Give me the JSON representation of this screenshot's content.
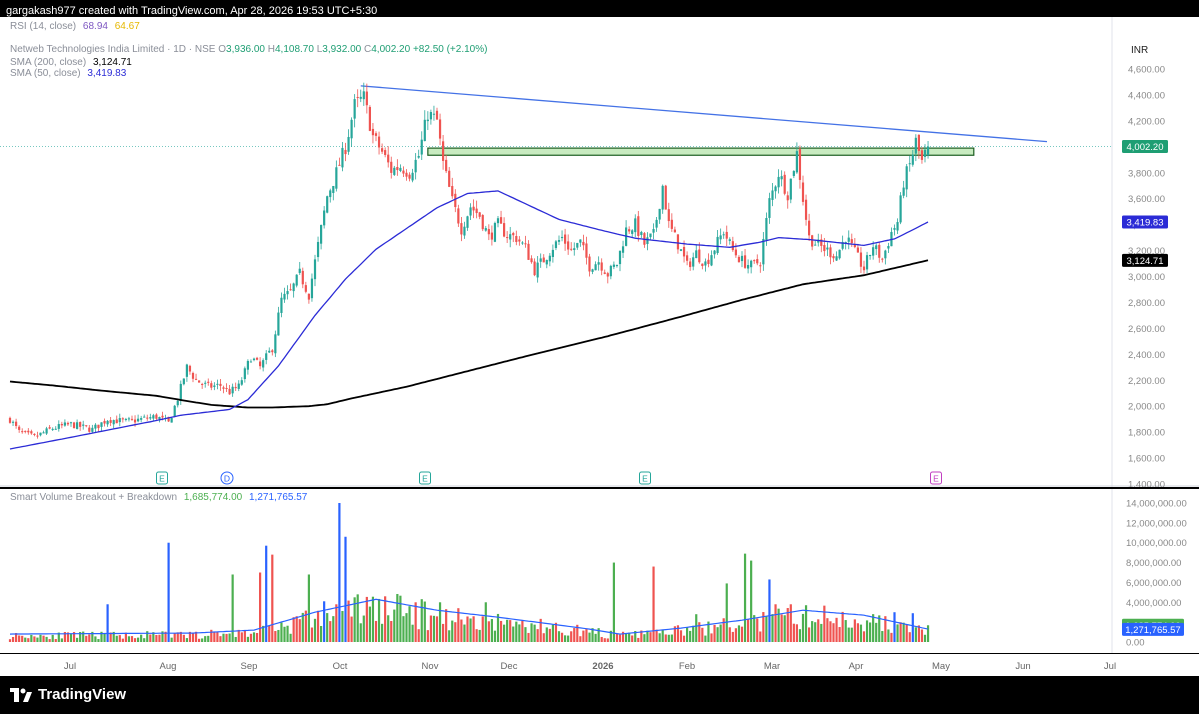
{
  "header": {
    "caption": "gargakash977 created with TradingView.com, Apr 28, 2026 19:53 UTC+5:30"
  },
  "rsi": {
    "label": "RSI (14, close)",
    "v1": "68.94",
    "v2": "64.67"
  },
  "legend": {
    "symbol": "Netweb Technologies India Limited · 1D · NSE",
    "o_label": "O",
    "o": "3,936.00",
    "h_label": "H",
    "h": "4,108.70",
    "l_label": "L",
    "l": "3,932.00",
    "c_label": "C",
    "c": "4,002.20",
    "change": "+82.50 (+2.10%)",
    "sma200_label": "SMA (200, close)",
    "sma200": "3,124.71",
    "sma50_label": "SMA (50, close)",
    "sma50": "3,419.83"
  },
  "volume_legend": {
    "label": "Smart Volume Breakout + Breakdown",
    "v1": "1,685,774.00",
    "v2": "1,271,765.57"
  },
  "currency": "INR",
  "footer": {
    "brand": "TradingView"
  },
  "colors": {
    "up": "#26a69a",
    "down": "#ef5350",
    "sma50": "#2b2bd6",
    "sma200": "#000000",
    "trendline": "#4472e6",
    "vol_green": "#4caf50",
    "vol_red": "#ef5350",
    "vol_blue": "#2962ff"
  },
  "chart_data": {
    "type": "candlestick",
    "price_axis": {
      "ylim": [
        1400,
        4700
      ],
      "ticks": [
        "1,400.00",
        "1,600.00",
        "1,800.00",
        "2,000.00",
        "2,200.00",
        "2,400.00",
        "2,600.00",
        "2,800.00",
        "3,000.00",
        "3,200.00",
        "3,400.00",
        "3,600.00",
        "3,800.00",
        "4,000.00",
        "4,200.00",
        "4,400.00",
        "4,600.00"
      ]
    },
    "price_labels": [
      {
        "text": "4,002.20",
        "value": 4002.2,
        "color": "#1e9e73"
      },
      {
        "text": "3,419.83",
        "value": 3419.83,
        "color": "#2b2bd6"
      },
      {
        "text": "3,124.71",
        "value": 3124.71,
        "color": "#000000"
      }
    ],
    "volume_axis": {
      "ylim": [
        0,
        15000000
      ],
      "ticks": [
        "0.00",
        "2,000,000.00",
        "4,000,000.00",
        "6,000,000.00",
        "8,000,000.00",
        "10,000,000.00",
        "12,000,000.00",
        "14,000,000.00"
      ]
    },
    "volume_labels": [
      {
        "text": "1,685,774.00",
        "value": 1685774,
        "color": "#4caf50"
      },
      {
        "text": "1,271,765.57",
        "value": 1271765.57,
        "color": "#2962ff"
      }
    ],
    "x_labels": [
      "Jul",
      "Aug",
      "Sep",
      "Oct",
      "Nov",
      "Dec",
      "2026",
      "Feb",
      "Mar",
      "Apr",
      "May",
      "Jun",
      "Jul"
    ],
    "events": [
      "E",
      "D",
      "E",
      "E",
      "E"
    ],
    "anchors": [
      [
        0,
        1900
      ],
      [
        3,
        1800
      ],
      [
        8,
        1760
      ],
      [
        14,
        1830
      ],
      [
        20,
        1860
      ],
      [
        27,
        1820
      ],
      [
        32,
        1900
      ],
      [
        38,
        1880
      ],
      [
        43,
        1900
      ],
      [
        48,
        1920
      ],
      [
        52,
        1870
      ],
      [
        55,
        2060
      ],
      [
        58,
        2300
      ],
      [
        61,
        2200
      ],
      [
        65,
        2150
      ],
      [
        69,
        2160
      ],
      [
        72,
        2110
      ],
      [
        75,
        2150
      ],
      [
        79,
        2380
      ],
      [
        82,
        2300
      ],
      [
        86,
        2450
      ],
      [
        89,
        2820
      ],
      [
        92,
        2880
      ],
      [
        95,
        3020
      ],
      [
        98,
        2860
      ],
      [
        101,
        3240
      ],
      [
        104,
        3620
      ],
      [
        107,
        3800
      ],
      [
        110,
        4000
      ],
      [
        113,
        4320
      ],
      [
        116,
        4380
      ],
      [
        119,
        4080
      ],
      [
        122,
        3960
      ],
      [
        125,
        3820
      ],
      [
        128,
        3850
      ],
      [
        131,
        3800
      ],
      [
        134,
        3930
      ],
      [
        137,
        4260
      ],
      [
        140,
        4200
      ],
      [
        142,
        3870
      ],
      [
        145,
        3580
      ],
      [
        148,
        3370
      ],
      [
        151,
        3540
      ],
      [
        154,
        3470
      ],
      [
        157,
        3300
      ],
      [
        160,
        3400
      ],
      [
        163,
        3320
      ],
      [
        166,
        3300
      ],
      [
        169,
        3220
      ],
      [
        172,
        3050
      ],
      [
        175,
        3130
      ],
      [
        178,
        3230
      ],
      [
        181,
        3300
      ],
      [
        184,
        3200
      ],
      [
        187,
        3260
      ],
      [
        190,
        3080
      ],
      [
        193,
        3120
      ],
      [
        196,
        3020
      ],
      [
        199,
        3100
      ],
      [
        202,
        3360
      ],
      [
        205,
        3400
      ],
      [
        208,
        3250
      ],
      [
        211,
        3320
      ],
      [
        214,
        3700
      ],
      [
        216,
        3400
      ],
      [
        219,
        3250
      ],
      [
        222,
        3080
      ],
      [
        225,
        3180
      ],
      [
        228,
        3100
      ],
      [
        231,
        3220
      ],
      [
        234,
        3350
      ],
      [
        237,
        3200
      ],
      [
        240,
        3120
      ],
      [
        243,
        3080
      ],
      [
        246,
        3120
      ],
      [
        249,
        3580
      ],
      [
        252,
        3800
      ],
      [
        255,
        3640
      ],
      [
        258,
        3950
      ],
      [
        260,
        3600
      ],
      [
        262,
        3300
      ],
      [
        265,
        3240
      ],
      [
        268,
        3200
      ],
      [
        271,
        3160
      ],
      [
        274,
        3310
      ],
      [
        277,
        3180
      ],
      [
        280,
        3060
      ],
      [
        283,
        3240
      ],
      [
        286,
        3130
      ],
      [
        289,
        3340
      ],
      [
        291,
        3420
      ],
      [
        293,
        3730
      ],
      [
        295,
        3860
      ],
      [
        297,
        4040
      ],
      [
        299,
        3880
      ],
      [
        301,
        4002
      ]
    ],
    "sma50": [
      [
        0,
        1670
      ],
      [
        20,
        1760
      ],
      [
        46,
        1880
      ],
      [
        56,
        1930
      ],
      [
        72,
        1975
      ],
      [
        78,
        2050
      ],
      [
        88,
        2310
      ],
      [
        100,
        2700
      ],
      [
        110,
        2980
      ],
      [
        120,
        3210
      ],
      [
        140,
        3530
      ],
      [
        150,
        3640
      ],
      [
        160,
        3660
      ],
      [
        170,
        3550
      ],
      [
        180,
        3440
      ],
      [
        195,
        3350
      ],
      [
        205,
        3295
      ],
      [
        222,
        3250
      ],
      [
        236,
        3225
      ],
      [
        246,
        3265
      ],
      [
        252,
        3300
      ],
      [
        262,
        3285
      ],
      [
        280,
        3240
      ],
      [
        290,
        3290
      ],
      [
        296,
        3360
      ],
      [
        301,
        3420
      ]
    ],
    "sma200": [
      [
        0,
        2190
      ],
      [
        14,
        2160
      ],
      [
        30,
        2120
      ],
      [
        48,
        2080
      ],
      [
        58,
        2040
      ],
      [
        66,
        2010
      ],
      [
        78,
        1990
      ],
      [
        86,
        1990
      ],
      [
        98,
        2000
      ],
      [
        104,
        2015
      ],
      [
        112,
        2060
      ],
      [
        130,
        2150
      ],
      [
        150,
        2270
      ],
      [
        170,
        2390
      ],
      [
        196,
        2540
      ],
      [
        220,
        2690
      ],
      [
        240,
        2820
      ],
      [
        260,
        2940
      ],
      [
        280,
        3010
      ],
      [
        301,
        3125
      ]
    ],
    "trendline": {
      "from": [
        115,
        4470
      ],
      "to": [
        340,
        4040
      ]
    },
    "zone": {
      "from": 137,
      "to": 316,
      "low": 3935,
      "high": 3990
    },
    "volume": {
      "base_millions": 1.0,
      "ma_millions": [
        [
          0,
          0.8
        ],
        [
          60,
          0.9
        ],
        [
          80,
          1.2
        ],
        [
          100,
          3.0
        ],
        [
          120,
          4.3
        ],
        [
          140,
          3.2
        ],
        [
          160,
          2.5
        ],
        [
          190,
          1.3
        ],
        [
          200,
          0.8
        ],
        [
          220,
          1.4
        ],
        [
          240,
          2.2
        ],
        [
          260,
          3.2
        ],
        [
          280,
          2.7
        ],
        [
          301,
          1.3
        ]
      ],
      "spikes": [
        [
          32,
          3.8,
          "blue"
        ],
        [
          52,
          10.0,
          "blue"
        ],
        [
          73,
          6.8,
          "green"
        ],
        [
          82,
          7.0,
          "red"
        ],
        [
          84,
          9.7,
          "blue"
        ],
        [
          86,
          8.8,
          "red"
        ],
        [
          98,
          6.8,
          "green"
        ],
        [
          103,
          4.1,
          "blue"
        ],
        [
          108,
          14.0,
          "blue"
        ],
        [
          110,
          10.6,
          "blue"
        ],
        [
          114,
          4.8,
          "green"
        ],
        [
          133,
          4.0,
          "red"
        ],
        [
          141,
          4.0,
          "green"
        ],
        [
          156,
          4.0,
          "green"
        ],
        [
          198,
          8.0,
          "green"
        ],
        [
          211,
          7.6,
          "red"
        ],
        [
          225,
          2.8,
          "green"
        ],
        [
          235,
          5.9,
          "green"
        ],
        [
          241,
          8.9,
          "green"
        ],
        [
          243,
          8.2,
          "green"
        ],
        [
          249,
          6.3,
          "blue"
        ],
        [
          251,
          3.8,
          "red"
        ],
        [
          256,
          3.8,
          "red"
        ],
        [
          290,
          3.0,
          "blue"
        ],
        [
          296,
          2.9,
          "blue"
        ]
      ]
    }
  }
}
